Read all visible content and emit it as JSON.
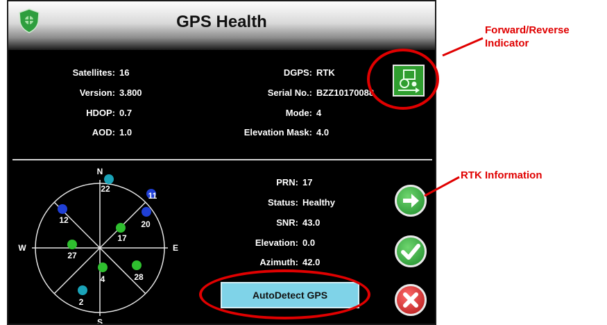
{
  "title": "GPS Health",
  "info_left": [
    {
      "label": "Satellites:",
      "value": "16"
    },
    {
      "label": "Version:",
      "value": "3.800"
    },
    {
      "label": "HDOP:",
      "value": "0.7"
    },
    {
      "label": "AOD:",
      "value": "1.0"
    }
  ],
  "info_right": [
    {
      "label": "DGPS:",
      "value": "RTK"
    },
    {
      "label": "Serial No.:",
      "value": "BZZ10170088"
    },
    {
      "label": "Mode:",
      "value": "4"
    },
    {
      "label": "Elevation Mask:",
      "value": "4.0"
    }
  ],
  "satellite_detail": [
    {
      "label": "PRN:",
      "value": "17"
    },
    {
      "label": "Status:",
      "value": "Healthy"
    },
    {
      "label": "SNR:",
      "value": "43.0"
    },
    {
      "label": "Elevation:",
      "value": "0.0"
    },
    {
      "label": "Azimuth:",
      "value": "42.0"
    }
  ],
  "compass": {
    "n": "N",
    "s": "S",
    "e": "E",
    "w": "W"
  },
  "satellites": [
    {
      "prn": "22",
      "color": "#1aa3b8"
    },
    {
      "prn": "11",
      "color": "#1f3fd6"
    },
    {
      "prn": "20",
      "color": "#1f3fd6"
    },
    {
      "prn": "12",
      "color": "#1f3fd6"
    },
    {
      "prn": "17",
      "color": "#2fbf2f"
    },
    {
      "prn": "27",
      "color": "#2fbf2f"
    },
    {
      "prn": "4",
      "color": "#2fbf2f"
    },
    {
      "prn": "28",
      "color": "#2fbf2f"
    },
    {
      "prn": "2",
      "color": "#1aa3b8"
    }
  ],
  "autodetect_label": "AutoDetect GPS",
  "icons": {
    "forward_reverse": "tractor-forward-icon",
    "next": "arrow-right-icon",
    "accept": "checkmark-icon",
    "cancel": "close-icon",
    "logo": "shield-logo-icon"
  },
  "callouts": {
    "forward_reverse": "Forward/Reverse Indicator",
    "rtk": "RTK Information"
  },
  "colors": {
    "accent_red": "#e00000",
    "button_green": "#2f9e2f",
    "button_cyan": "#7fd3e8"
  }
}
